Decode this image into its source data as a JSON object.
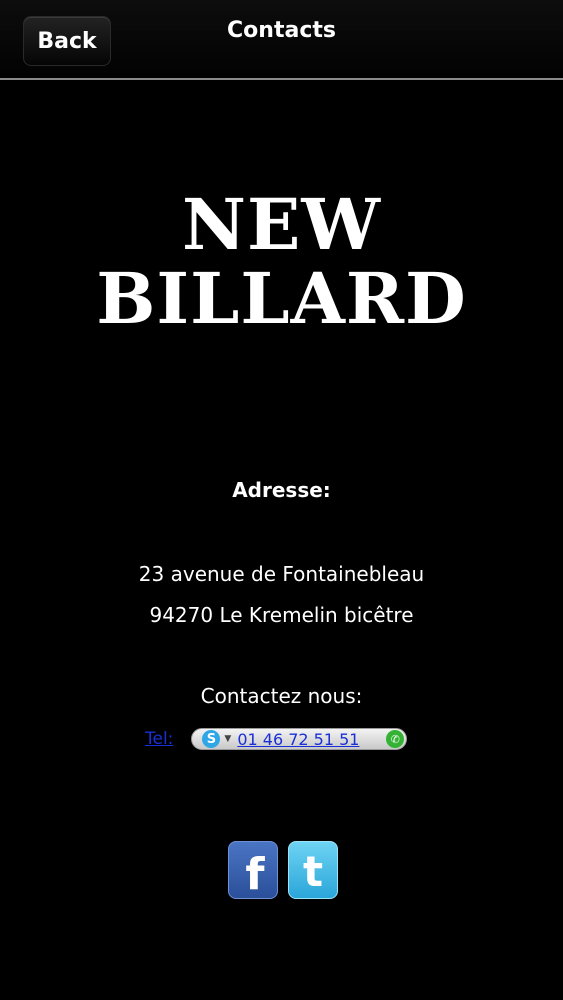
{
  "header": {
    "back_label": "Back",
    "title": "Contacts"
  },
  "brand": {
    "line1": "NEW",
    "line2": "BILLARD"
  },
  "address": {
    "heading": "Adresse:",
    "line1": "23 avenue de Fontainebleau",
    "line2": "94270 Le Kremelin bicêtre"
  },
  "contact": {
    "heading": "Contactez nous:",
    "tel_label": "Tel:",
    "skype_glyph": "S",
    "phone_number": "01 46 72 51 51"
  },
  "social": {
    "facebook_glyph": "f",
    "twitter_glyph": "t"
  },
  "icons": {
    "skype": "skype-icon",
    "call": "phone-call-icon",
    "dropdown": "dropdown-arrow-icon",
    "facebook": "facebook-icon",
    "twitter": "twitter-icon"
  },
  "colors": {
    "background": "#000000",
    "link": "#1a2fd6",
    "facebook": "#3b5998",
    "twitter": "#33b5e5",
    "call_green": "#34b233"
  }
}
